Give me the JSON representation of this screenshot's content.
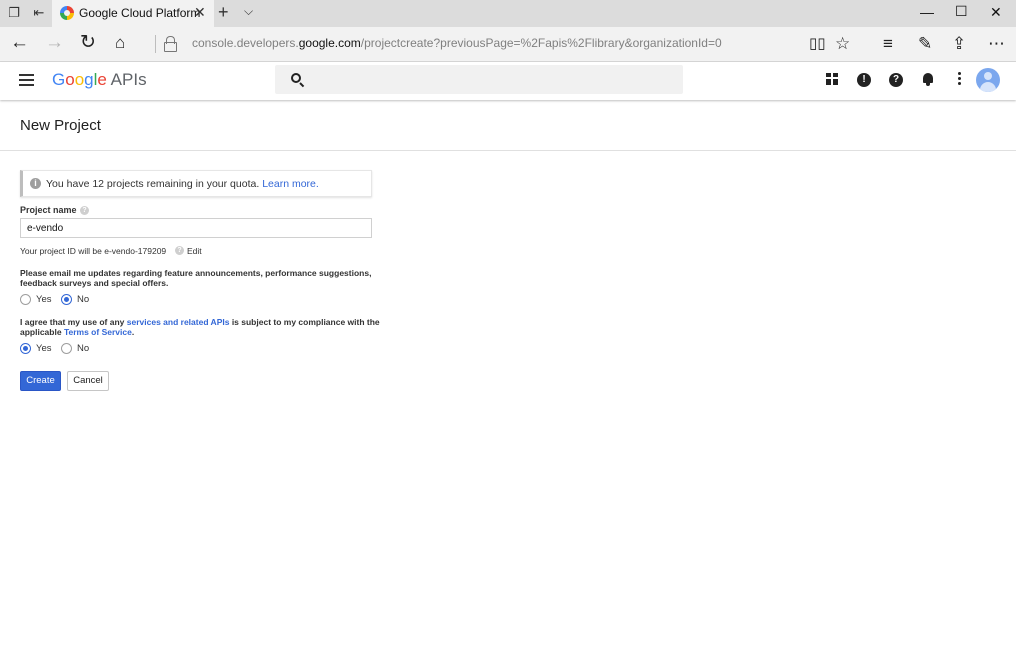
{
  "browser": {
    "tab_title": "Google Cloud Platform",
    "url_prefix": "console.developers.",
    "url_domain": "google.com",
    "url_rest": "/projectcreate?previousPage=%2Fapis%2Flibrary&organizationId=0"
  },
  "header": {
    "logo_letters": [
      "G",
      "o",
      "o",
      "g",
      "l",
      "e"
    ],
    "logo_suffix": " APIs",
    "search_placeholder": ""
  },
  "page": {
    "title": "New Project",
    "quota_text": "You have 12 projects remaining in your quota.",
    "quota_link": "Learn more.",
    "project_name_label": "Project name",
    "project_name_value": "e-vendo",
    "project_id_text": "Your project ID will be e-vendo-179209",
    "project_id_edit": "Edit",
    "email_question": "Please email me updates regarding feature announcements, performance suggestions, feedback surveys and special offers.",
    "email_options": {
      "yes": "Yes",
      "no": "No",
      "selected": "No"
    },
    "tos_part1": "I agree that my use of any ",
    "tos_link1": "services and related APIs",
    "tos_part2": " is subject to my compliance with the applicable ",
    "tos_link2": "Terms of Service",
    "tos_part3": ".",
    "tos_options": {
      "yes": "Yes",
      "no": "No",
      "selected": "Yes"
    },
    "create_label": "Create",
    "cancel_label": "Cancel"
  },
  "icons": [
    "tab-actions-icon",
    "set-aside-tabs-icon",
    "new-tab-icon",
    "tab-preview-icon",
    "minimize-icon",
    "maximize-icon",
    "close-window-icon",
    "back-icon",
    "forward-icon",
    "refresh-icon",
    "home-icon",
    "lock-icon",
    "reading-view-icon",
    "favorite-star-icon",
    "hub-icon",
    "web-note-icon",
    "share-icon",
    "more-icon",
    "menu-icon",
    "search-icon",
    "gift-icon",
    "feedback-icon",
    "help-icon",
    "notifications-icon",
    "more-vert-icon",
    "avatar",
    "info-icon"
  ],
  "colors": {
    "link": "#3367d6",
    "primary_button": "#3367d6"
  }
}
